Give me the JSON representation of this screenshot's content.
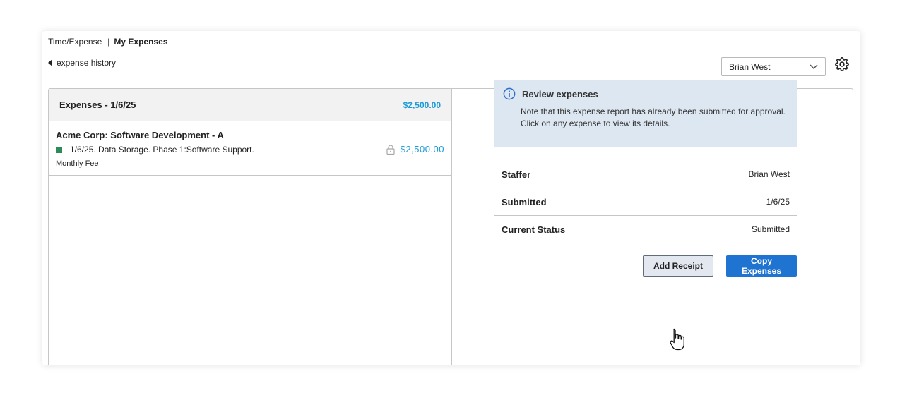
{
  "breadcrumb": {
    "parent": "Time/Expense",
    "separator": "|",
    "current": "My Expenses"
  },
  "back_link": "expense history",
  "staffer_select": {
    "value": "Brian West",
    "icon": "chevron-down-icon"
  },
  "settings_icon": "gear-icon",
  "expense_list": {
    "title": "Expenses - 1/6/25",
    "total": "$2,500.00",
    "items": [
      {
        "project": "Acme Corp: Software Development - A",
        "description": "1/6/25. Data Storage. Phase 1:Software Support.",
        "sub": "Monthly Fee",
        "amount": "$2,500.00",
        "status_color": "#2e8b57",
        "icon": "lock-icon"
      }
    ]
  },
  "review": {
    "title": "Review expenses",
    "line1": "Note that this expense report has already been submitted for approval.",
    "line2": "Click on any expense to view its details.",
    "icon": "info-icon"
  },
  "details": [
    {
      "label": "Staffer",
      "value": "Brian West"
    },
    {
      "label": "Submitted",
      "value": "1/6/25"
    },
    {
      "label": "Current Status",
      "value": "Submitted"
    }
  ],
  "buttons": {
    "add_receipt": "Add Receipt",
    "copy_expenses": "Copy Expenses"
  },
  "colors": {
    "accent": "#1a9ad6",
    "primary_button": "#1f73d1",
    "info_bg": "#dde7f1"
  }
}
